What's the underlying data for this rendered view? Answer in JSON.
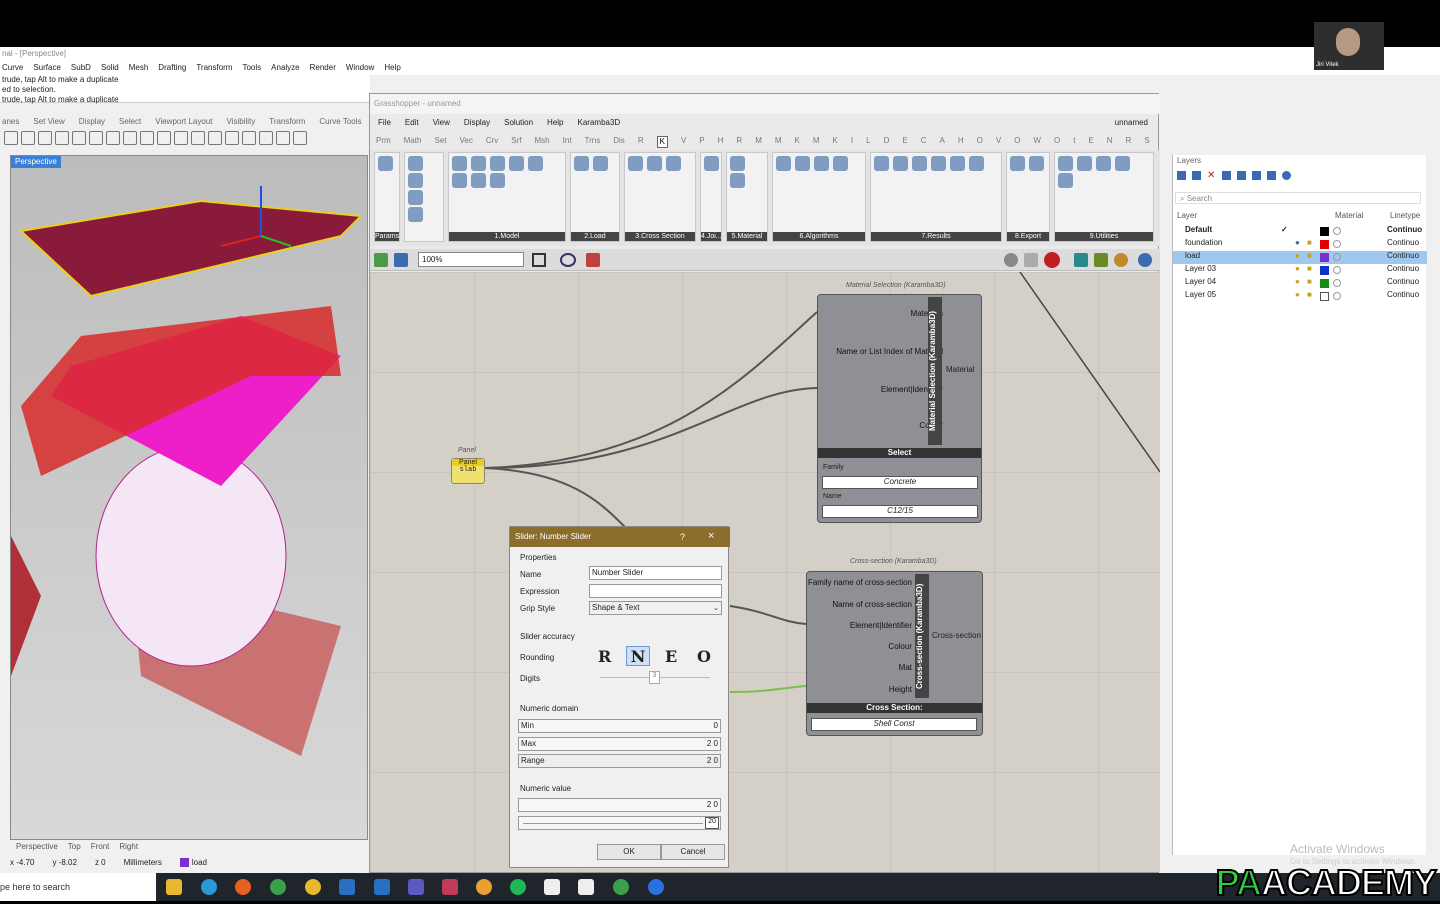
{
  "rhino": {
    "title": "nal - [Perspective]",
    "menu": [
      "Curve",
      "Surface",
      "SubD",
      "Solid",
      "Mesh",
      "Drafting",
      "Transform",
      "Tools",
      "Analyze",
      "Render",
      "Window",
      "Help"
    ],
    "cmd_lines": [
      "trude, tap Alt to make a duplicate",
      "ed to selection.",
      "trude, tap Alt to make a duplicate"
    ],
    "toolbar_tabs": [
      "anes",
      "Set View",
      "Display",
      "Select",
      "Viewport Layout",
      "Visibility",
      "Transform",
      "Curve Tools"
    ],
    "viewport_label": "Perspective",
    "view_tabs": [
      "Perspective",
      "Top",
      "Front",
      "Right"
    ],
    "status": {
      "x": "x -4.70",
      "y": "y -8.02",
      "z": "z 0",
      "units": "Millimeters",
      "layer": "load"
    }
  },
  "gh": {
    "title": "Grasshopper - unnamed",
    "menu": [
      "File",
      "Edit",
      "View",
      "Display",
      "Solution",
      "Help",
      "Karamba3D"
    ],
    "file_name": "unnamed",
    "tabs": [
      "Prm",
      "Math",
      "Set",
      "Vec",
      "Crv",
      "Srf",
      "Msh",
      "Int",
      "Trns",
      "Dis",
      "R",
      "K",
      "V",
      "P",
      "H",
      "R",
      "M",
      "M",
      "K",
      "M",
      "K",
      "I",
      "L",
      "D",
      "E",
      "C",
      "A",
      "H",
      "O",
      "V",
      "O",
      "W",
      "O",
      "t",
      "E",
      "N",
      "R",
      "S"
    ],
    "active_tab": "K",
    "ribbon_groups": [
      "Params",
      "1.Model",
      "2.Load",
      "3.Cross Section",
      "4.Joi...",
      "5.Material",
      "6.Algorithms",
      "7.Results",
      "8.Export",
      "9.Utilities"
    ],
    "zoom": "100%"
  },
  "canvas": {
    "panel": {
      "title": "Panel",
      "header": "Panel",
      "value": "slab"
    },
    "material_selection": {
      "title": "Material Selection (Karamba3D)",
      "vertical_label": "Material Selection (Karamba3D)",
      "inputs": [
        "Materials",
        "Name or List Index of Material",
        "Element|Identifier",
        "Colour"
      ],
      "output": "Material",
      "select_label": "Select",
      "family_label": "Family",
      "family_value": "Concrete",
      "name_label": "Name",
      "name_value": "C12/15"
    },
    "cross_section": {
      "title": "Cross-section (Karamba3D)",
      "vertical_label": "Cross-section (Karamba3D)",
      "inputs": [
        "Family name of cross-section",
        "Name of cross-section",
        "Element|Identifier",
        "Colour",
        "Mat",
        "Height"
      ],
      "output": "Cross-section",
      "bar_label": "Cross Section:",
      "value": "Shell Const"
    }
  },
  "dialog": {
    "title": "Slider: Number Slider",
    "help": "?",
    "close": "×",
    "properties_label": "Properties",
    "name_label": "Name",
    "name_value": "Number Slider",
    "expression_label": "Expression",
    "expression_value": "",
    "grip_label": "Grip Style",
    "grip_value": "Shape & Text",
    "accuracy_label": "Slider accuracy",
    "rounding_label": "Rounding",
    "rounding_options": [
      "R",
      "N",
      "E",
      "O"
    ],
    "rounding_selected": "N",
    "digits_label": "Digits",
    "digits_value": "3",
    "domain_label": "Numeric domain",
    "min_label": "Min",
    "min_value": "0",
    "max_label": "Max",
    "max_value": "2 0",
    "range_label": "Range",
    "range_value": "2 0",
    "value_label": "Numeric value",
    "value_value": "2 0",
    "slider_value": "20",
    "ok": "OK",
    "cancel": "Cancel"
  },
  "layers": {
    "title": "Layers",
    "search_placeholder": "Search",
    "headers": {
      "layer": "Layer",
      "material": "Material",
      "linetype": "Linetype"
    },
    "rows": [
      {
        "name": "Default",
        "linetype": "Continuo",
        "color": "#000000"
      },
      {
        "name": "foundation",
        "linetype": "Continuo",
        "color": "#e00000"
      },
      {
        "name": "load",
        "linetype": "Continuo",
        "color": "#7a2fd0"
      },
      {
        "name": "Layer 03",
        "linetype": "Continuo",
        "color": "#1030d0"
      },
      {
        "name": "Layer 04",
        "linetype": "Continuo",
        "color": "#138a13"
      },
      {
        "name": "Layer 05",
        "linetype": "Continuo",
        "color": "#ffffff"
      }
    ]
  },
  "taskbar": {
    "search": "pe here to search"
  },
  "watermark": {
    "line1": "Activate Windows",
    "line2": "Go to Settings to activate Windows."
  },
  "logo": "PAACADEMY",
  "webcam_name": "Jiri Vitek"
}
